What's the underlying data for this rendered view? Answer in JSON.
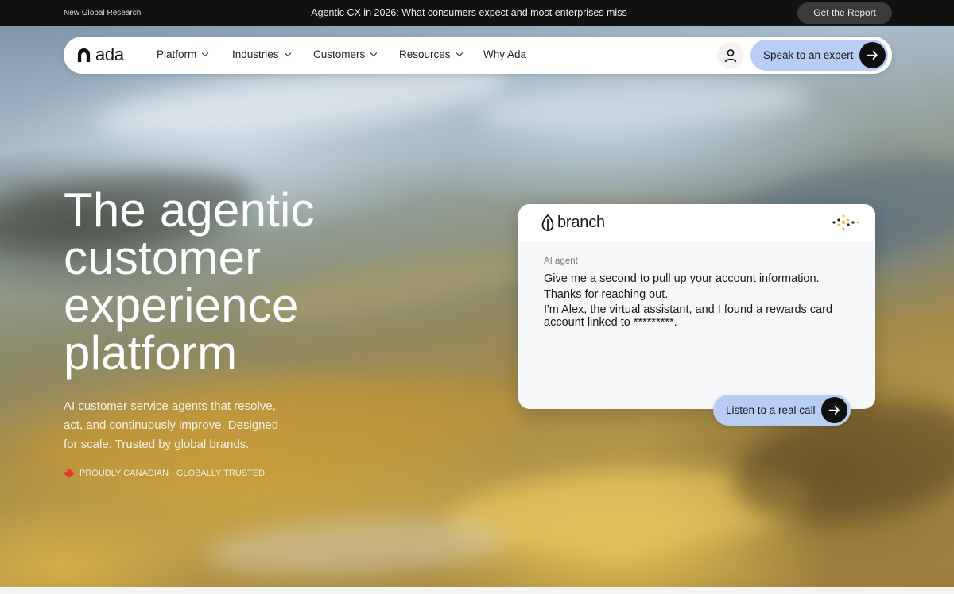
{
  "announcement": {
    "left_text": "New Global Research",
    "center_text": "Agentic CX in 2026: What consumers expect and most enterprises miss",
    "cta_label": "Get the Report"
  },
  "nav": {
    "logo_text": "ada",
    "items": [
      {
        "label": "Platform",
        "has_dropdown": true
      },
      {
        "label": "Industries",
        "has_dropdown": true
      },
      {
        "label": "Customers",
        "has_dropdown": true
      },
      {
        "label": "Resources",
        "has_dropdown": true
      },
      {
        "label": "Why Ada",
        "has_dropdown": false
      }
    ],
    "user_icon": "user-icon",
    "cta_label": "Speak to an expert",
    "cta_icon": "arrow-right-icon"
  },
  "hero": {
    "headline_lines": [
      "The agentic",
      "customer",
      "experience",
      "platform"
    ],
    "subtext": "AI customer service agents that resolve, act, and continuously improve. Designed for scale. Trusted by global brands.",
    "badge_icon": "maple-leaf-icon",
    "badge_text": "PROUDLY CANADIAN · GLOBALLY TRUSTED"
  },
  "chat_card": {
    "brand_name": "branch",
    "brand_icon": "leaf-icon",
    "status_icon": "voice-dots-icon",
    "agent_label": "AI agent",
    "messages": [
      "Give me a second to pull up your account information.",
      "Thanks for reaching out.",
      "I'm Alex, the virtual assistant, and I found a rewards card account linked to *********."
    ],
    "cta_label": "Listen to a real call"
  },
  "colors": {
    "accent_button": "#b7cdf3",
    "dark": "#0f0f0f",
    "announcement_bg": "#111111"
  }
}
